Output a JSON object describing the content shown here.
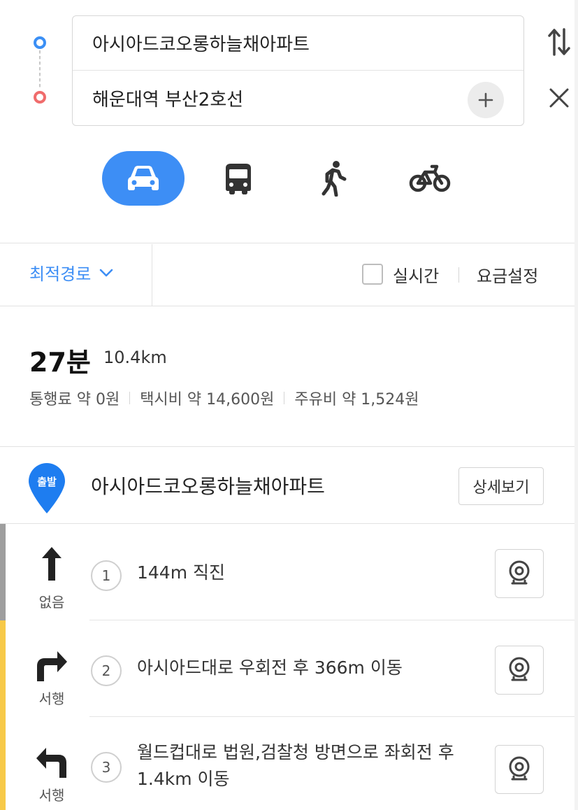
{
  "route": {
    "origin": "아시아드코오롱하늘채아파트",
    "destination": "해운대역 부산2호선"
  },
  "modes": [
    {
      "name": "car",
      "icon": "car-icon",
      "active": true
    },
    {
      "name": "transit",
      "icon": "bus-icon",
      "active": false
    },
    {
      "name": "walk",
      "icon": "walk-icon",
      "active": false
    },
    {
      "name": "bike",
      "icon": "bike-icon",
      "active": false
    }
  ],
  "options": {
    "route_type": "최적경로",
    "realtime_label": "실시간",
    "fare_setting_label": "요금설정"
  },
  "summary": {
    "time": "27분",
    "distance": "10.4km",
    "toll": "통행료 약 0원",
    "taxi": "택시비 약 14,600원",
    "fuel": "주유비 약 1,524원"
  },
  "start": {
    "badge": "출발",
    "name": "아시아드코오롱하늘채아파트",
    "detail_label": "상세보기"
  },
  "steps": [
    {
      "num": "1",
      "text": "144m 직진",
      "road": "없음",
      "arrow": "straight-arrow-icon",
      "bar_color": "#9e9e9e"
    },
    {
      "num": "2",
      "text": "아시아드대로 우회전 후 366m 이동",
      "road": "서행",
      "arrow": "turn-right-arrow-icon",
      "bar_color": "#f7c948"
    },
    {
      "num": "3",
      "text": "월드컵대로 법원,검찰청 방면으로 좌회전 후 1.4km 이동",
      "road": "서행",
      "arrow": "turn-left-arrow-icon",
      "bar_color": "#f7c948"
    }
  ],
  "colors": {
    "accent": "#3d8ef5",
    "origin_dot": "#3b8ff5",
    "destination_dot": "#f06c6c",
    "traffic_none": "#9e9e9e",
    "traffic_slow": "#f7c948"
  }
}
